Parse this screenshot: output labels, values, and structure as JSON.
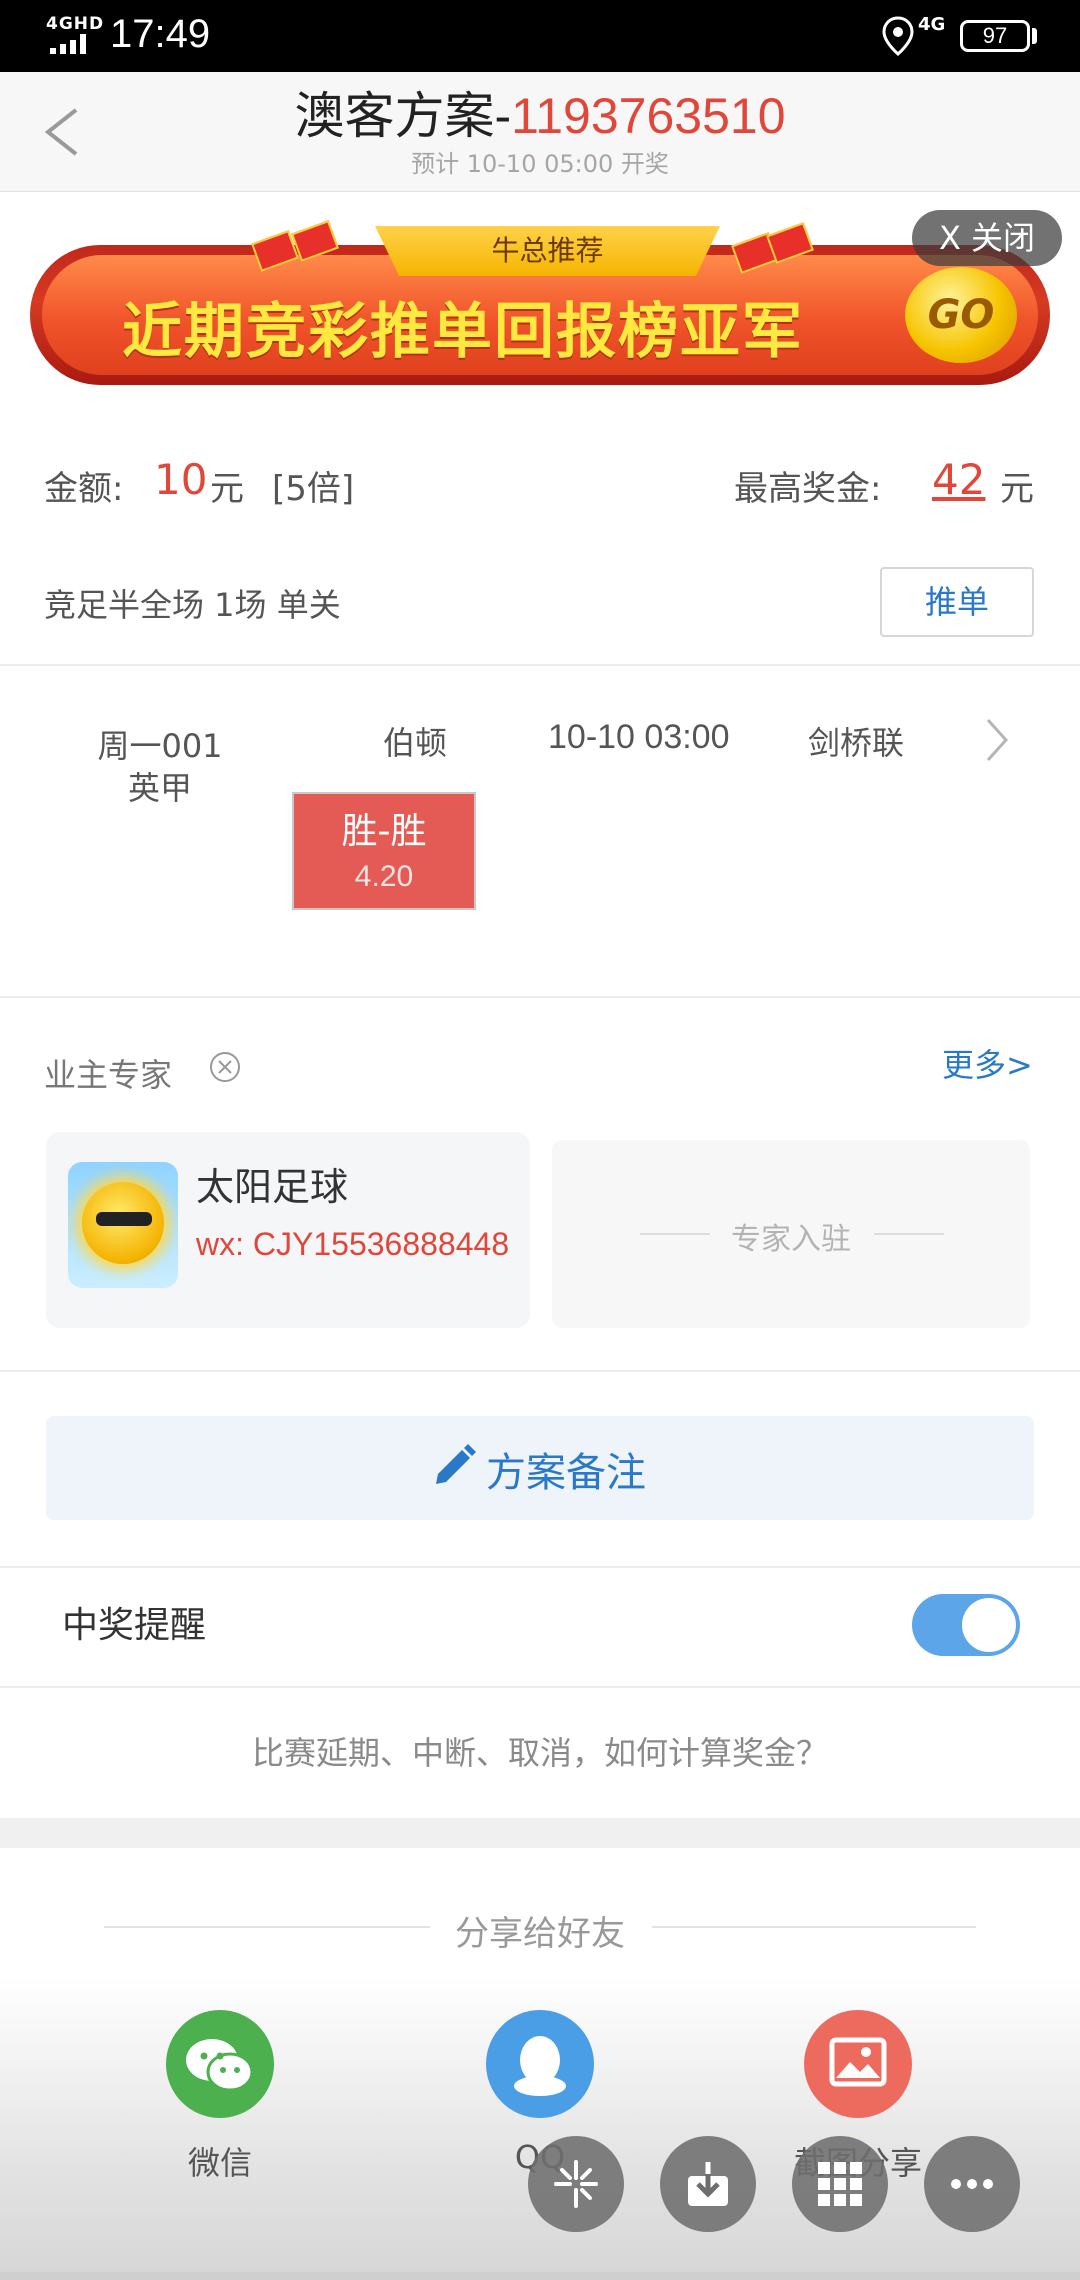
{
  "status_bar": {
    "network": "4GHD",
    "time": "17:49",
    "mobile": "4G",
    "battery": "97"
  },
  "header": {
    "title_prefix": "澳客方案-",
    "plan_id": "1193763510",
    "subtitle": "预计 10-10 05:00 开奖"
  },
  "banner": {
    "tag": "牛总推荐",
    "text": "近期竞彩推单回报榜亚军",
    "go_label": "GO",
    "close_label": "X 关闭"
  },
  "bet": {
    "amount_label": "金额:",
    "amount_value": "10",
    "amount_unit": "元",
    "multiplier": "[5倍]",
    "max_prize_label": "最高奖金:",
    "max_prize_value": "42",
    "max_prize_unit": "元",
    "type": "竞足半全场    1场 单关",
    "push_button": "推单"
  },
  "match": {
    "week_no": "周一001",
    "league": "英甲",
    "home_team": "伯顿",
    "time": "10-10 03:00",
    "away_team": "剑桥联",
    "pick_name": "胜-胜",
    "pick_odds": "4.20"
  },
  "owner_expert": {
    "label": "业主专家",
    "more_link": "更多>",
    "expert_name": "太阳足球",
    "expert_wx": "wx: CJY15536888448",
    "join_label": "专家入驻"
  },
  "notes_button": "方案备注",
  "prize_reminder": {
    "label": "中奖提醒",
    "enabled": true
  },
  "faq_link": "比赛延期、中断、取消，如何计算奖金？",
  "share": {
    "title": "分享给好友",
    "options": [
      {
        "label": "微信",
        "icon": "wechat-icon",
        "color": "#4cb04f"
      },
      {
        "label": "QQ",
        "icon": "qq-icon",
        "color": "#4a9ee6"
      },
      {
        "label": "截图分享",
        "icon": "image-icon",
        "color": "#ec6a5e"
      }
    ]
  },
  "floating_actions": [
    "flash-icon",
    "download-icon",
    "grid-icon",
    "more-icon"
  ],
  "colors": {
    "accent_red": "#e0473a",
    "link_blue": "#2a78c8",
    "toggle_blue": "#5ba5e8"
  }
}
